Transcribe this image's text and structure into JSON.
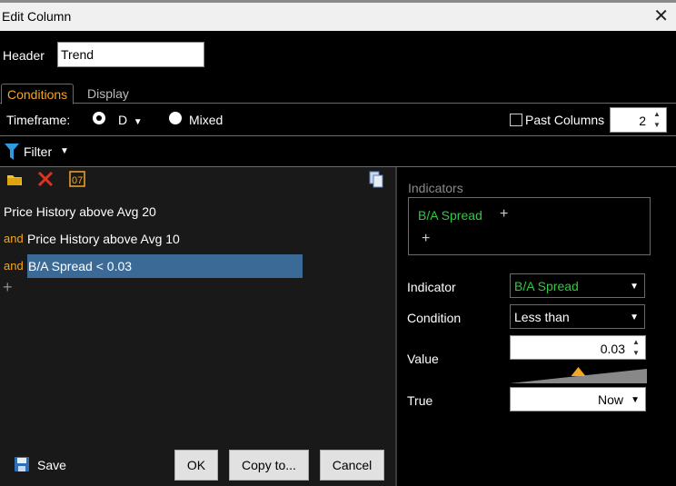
{
  "window": {
    "title": "Edit Column",
    "close_glyph": "✕"
  },
  "header": {
    "label": "Header",
    "value": "Trend"
  },
  "tabs": [
    {
      "label": "Conditions"
    },
    {
      "label": "Display"
    }
  ],
  "timeframe": {
    "label": "Timeframe:",
    "selected_value": "D",
    "mixed_label": "Mixed",
    "past_columns_label": "Past Columns",
    "past_columns_checked": false,
    "past_columns_value": "2"
  },
  "filter": {
    "label": "Filter"
  },
  "toolbar_icons": [
    "folder-icon",
    "delete-icon",
    "clock-icon",
    "copy-icon"
  ],
  "conditions": [
    {
      "connector": "",
      "text": "Price History above Avg 20"
    },
    {
      "connector": "and",
      "text": "Price History above Avg 10"
    },
    {
      "connector": "and",
      "text": "B/A Spread < 0.03",
      "selected": true
    }
  ],
  "add_symbol": "+",
  "footer": {
    "save_label": "Save",
    "ok_label": "OK",
    "copy_label": "Copy to...",
    "cancel_label": "Cancel"
  },
  "indicators_panel": {
    "section_label": "Indicators",
    "items": [
      "B/A Spread"
    ],
    "add_symbol": "+"
  },
  "fields": {
    "indicator_label": "Indicator",
    "indicator_value": "B/A Spread",
    "condition_label": "Condition",
    "condition_value": "Less than",
    "value_label": "Value",
    "value_value": "0.03",
    "true_label": "True",
    "true_value": "Now",
    "slider_level": 0.5
  },
  "colors": {
    "accent": "#f5a623",
    "indicator_green": "#2ecc40",
    "selection": "#3b6a96"
  }
}
